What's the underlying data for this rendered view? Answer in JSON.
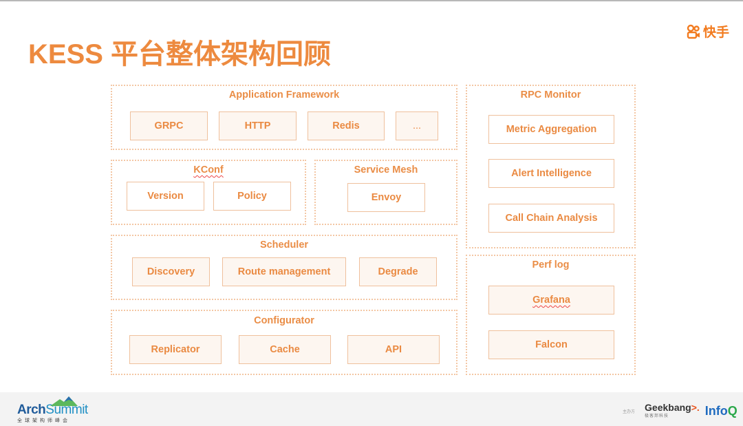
{
  "slide": {
    "title": "KESS 平台整体架构回顾",
    "brand_logo": {
      "icon": "kuaishou-camera-icon",
      "text": "快手",
      "color": "#f27b1f"
    }
  },
  "colors": {
    "accent": "#ed8a3f",
    "node_border": "#efc09c",
    "node_fill": "#fdf6f0",
    "group_border": "#f3c6a3",
    "footer_bg": "#f3f3f3"
  },
  "diagram": {
    "groups": {
      "application_framework": {
        "title": "Application Framework",
        "nodes": [
          "GRPC",
          "HTTP",
          "Redis",
          "..."
        ]
      },
      "kconf": {
        "title": "KConf",
        "nodes": [
          "Version",
          "Policy"
        ]
      },
      "service_mesh": {
        "title": "Service Mesh",
        "nodes": [
          "Envoy"
        ]
      },
      "scheduler": {
        "title": "Scheduler",
        "nodes": [
          "Discovery",
          "Route management",
          "Degrade"
        ]
      },
      "configurator": {
        "title": "Configurator",
        "nodes": [
          "Replicator",
          "Cache",
          "API"
        ]
      },
      "rpc_monitor": {
        "title": "RPC Monitor",
        "nodes": [
          "Metric Aggregation",
          "Alert Intelligence",
          "Call Chain Analysis"
        ]
      },
      "perf_log": {
        "title": "Perf log",
        "nodes": [
          "Grafana",
          "Falcon"
        ]
      }
    }
  },
  "footer": {
    "left_logo": {
      "word_a": "Arch",
      "word_b": "Summit",
      "subtitle": "全球架构师峰会"
    },
    "right_logos": {
      "label": "主办方",
      "geek_a": "Geekbang",
      "geek_arrow": ">.",
      "geek_sub": "极客邦科技",
      "infoq_a": "Info",
      "infoq_b": "Q"
    }
  }
}
